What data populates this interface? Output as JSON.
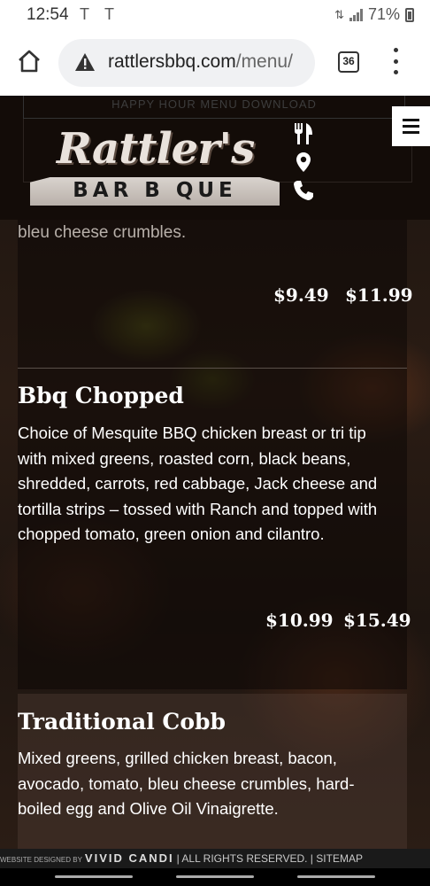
{
  "status_bar": {
    "time": "12:54",
    "notification_glyphs": [
      "T",
      "T"
    ],
    "battery": "71%"
  },
  "browser": {
    "url_host": "rattlersbbq.com",
    "url_path": "/menu/",
    "tab_count": "36"
  },
  "site": {
    "happy_hour_link": "HAPPY HOUR MENU DOWNLOAD",
    "logo_script": "Rattler's",
    "logo_bar": "BAR B QUE"
  },
  "menu": {
    "previous_item_tail": "bleu cheese crumbles.",
    "previous_prices": [
      "$9.49",
      "$11.99"
    ],
    "items": [
      {
        "title": "Bbq Chopped",
        "description": "Choice of Mesquite BBQ chicken breast or tri tip with mixed greens, roasted corn, black beans, shredded, carrots, red cabbage, Jack cheese and tortilla strips – tossed with Ranch and topped with chopped tomato, green onion and cilantro.",
        "prices": [
          "$10.99",
          "$15.49"
        ]
      },
      {
        "title": "Traditional Cobb",
        "description": "Mixed greens, grilled chicken breast, bacon, avocado, tomato, bleu cheese crumbles, hard-boiled egg and Olive Oil Vinaigrette."
      }
    ]
  },
  "footer": {
    "designed_by": "WEBSITE DESIGNED BY",
    "brand": "VIVID CANDI",
    "rights": "| ALL RIGHTS RESERVED. |",
    "sitemap": "SITEMAP"
  },
  "icons": {
    "home": "home-icon",
    "warning": "warning-icon",
    "more": "more-vert-icon",
    "utensils": "utensils-icon",
    "location": "map-pin-icon",
    "phone": "phone-icon",
    "menu": "hamburger-menu-icon"
  }
}
